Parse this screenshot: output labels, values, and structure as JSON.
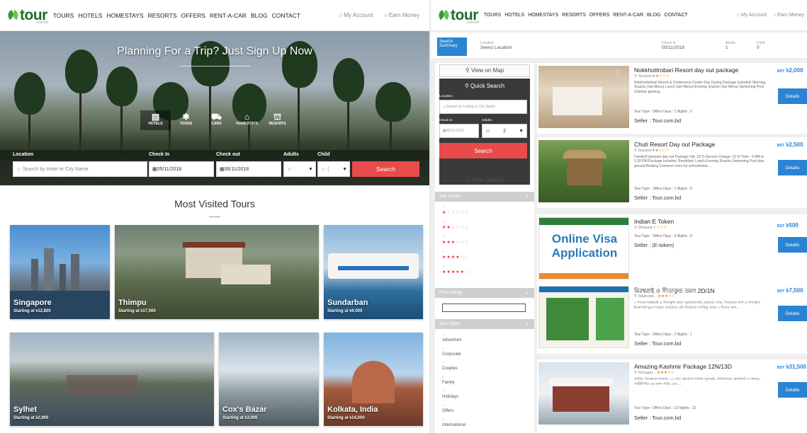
{
  "left": {
    "logo": {
      "word": "tour",
      "sub": ".com.bd"
    },
    "nav": [
      "TOURS",
      "HOTELS",
      "HOMESTAYS",
      "RESORTS",
      "OFFERS",
      "RENT-A-CAR",
      "BLOG",
      "CONTACT"
    ],
    "account": "My Account",
    "earn": "Earn Money",
    "hero": {
      "title": "Planning For a Trip? Just Sign Up Now",
      "categories": [
        {
          "label": "HOTELS",
          "icon": "building-icon"
        },
        {
          "label": "TOURS",
          "icon": "walker-icon"
        },
        {
          "label": "CARS",
          "icon": "car-icon"
        },
        {
          "label": "HOMESTAYS",
          "icon": "house-icon"
        },
        {
          "label": "RESORTS",
          "icon": "resort-icon"
        }
      ],
      "form": {
        "location_label": "Location",
        "location_placeholder": "Search by Hotel or City Name",
        "checkin_label": "Check In",
        "checkin_value": "05/11/2018",
        "checkout_label": "Check out",
        "checkout_value": "06/11/2018",
        "adults_label": "Adults",
        "adults_value": "",
        "child_label": "Child",
        "child_value": "",
        "search_label": "Search"
      }
    },
    "most_visited": {
      "title": "Most Visited Tours",
      "tiles": [
        {
          "name": "Singapore",
          "price": "Starting at ৳12,800"
        },
        {
          "name": "Thimpu",
          "price": "Starting at ৳17,000"
        },
        {
          "name": "Sundarban",
          "price": "Starting at ৳9,000"
        },
        {
          "name": "Sylhet",
          "price": "Starting at ৳2,900"
        },
        {
          "name": "Cox's Bazar",
          "price": "Starting at ৳3,000"
        },
        {
          "name": "Kolkata, India",
          "price": "Starting at ৳14,000"
        }
      ]
    }
  },
  "right": {
    "summary": {
      "tab": "Search Summary",
      "location_label": "Location",
      "location_value": "Select Location",
      "checkin_label": "Check in",
      "checkin_value": "05/11/2018",
      "adults_label": "Adults",
      "adults_value": "1",
      "child_label": "Child",
      "child_value": "0"
    },
    "sidebar": {
      "view_map": "View on Map",
      "quick_search": "Quick Search",
      "location_label": "Location",
      "location_placeholder": "Search by Listing or City Name",
      "checkin_label": "Check in",
      "checkin_value": "05/11/2018",
      "adults_label": "Adults",
      "adults_value": "2",
      "search_label": "Search",
      "filter_search": "Filter Search",
      "star_grade": "Star Grade",
      "price_range": "Price Range",
      "tour_types_label": "Tour Types",
      "tour_types": [
        "Adventure",
        "Corporate",
        "Couples",
        "Family",
        "Holidays",
        "Offers",
        "International"
      ]
    },
    "results": [
      {
        "title": "Nokkhottrobari Resort day out package",
        "location": "Sreepur",
        "stars": "★★☆☆☆",
        "desc": "Nokkhottrobari Resort & Conference Center Day Outing Package Included: Morning Snacks (Set Menu) Lunch (Set Menu) Evening Snacks (Set Menu) Swimming Pool Outdoor gaming...",
        "type": "Tour Type : Offers  Days : 1  Nights : 0",
        "seller": "Seller : Tour.com.bd",
        "currency": "BDT",
        "price": "৳2,000",
        "button": "Details"
      },
      {
        "title": "Chuti Resort Day out Package",
        "location": "Gazipur",
        "stars": "★★☆☆☆",
        "desc": "Family/Corporate day out Package Vat: 15 % Service Charge: 10 % Time : 9 AM to 6.30 PM Package Includes: Breakfast; Lunch Evening Snacks Swimming Pool play ground Boating Common room for refreshment ...",
        "type": "Tour Type : Offers  Days : 1  Nights : 0",
        "seller": "Seller : Tour.com.bd",
        "currency": "BDT",
        "price": "৳2,500",
        "button": "Details"
      },
      {
        "title": "Indian E Token",
        "location": "Dhaka",
        "stars": "★☆☆☆☆",
        "desc": "",
        "type": "Tour Type : Offers  Days : 0  Nights : 0",
        "seller": "Seller : (E-token)",
        "currency": "BDT",
        "price": "৳500",
        "button": "Details"
      },
      {
        "title": "মিরশ্বরাই ও সীতাকুন্ড ভ্রমণ 2D/1N",
        "location": "Sitakund,...",
        "stars": "★★★☆☆",
        "desc": "২ দিনের মিরশ্বরাই ও সীতাকুন্ড ভ্রমণ: মুহুরিপ্রজেক্ট, মহামায়া লেক, খৈয়াছড়া ঝর্ণা ও সীতাকুন্ড ইকোপার্ক ঘুরে আসুন। আমাদের এই প্যাকেজে সবকিছু আছে ২ দিনের জন্য...",
        "type": "Tour Type : Offers  Days : 2  Nights : 1",
        "seller": "Seller : Tour.com.bd",
        "currency": "BDT",
        "price": "৳7,500",
        "button": "Details"
      },
      {
        "title": "Amazing Kashmir Package 12N/13D",
        "location": "Srinagar,...",
        "stars": "★★★☆☆",
        "desc": "কাশ্মীর প্যাকেজে থাকছে: ১২ রাত হোটেলে থাকার সুব্যবস্থা, প্রতিদিনের ব্রেকফাস্ট ও ডিনার, সাইটসিয়িং এর জন্য গাড়ি এবং ...",
        "type": "Tour Type : Offers  Days : 13  Nights : 12",
        "seller": "Seller : Tour.com.bd",
        "currency": "BDT",
        "price": "৳31,500",
        "button": "Details"
      }
    ],
    "evisa": {
      "line1": "Online Visa",
      "line2": "Application"
    }
  }
}
